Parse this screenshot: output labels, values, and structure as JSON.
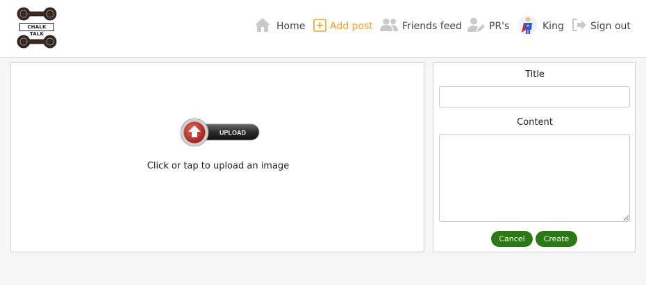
{
  "app": {
    "logo_text": "CHALK TALK"
  },
  "nav": {
    "home": "Home",
    "add_post": "Add post",
    "friends_feed": "Friends feed",
    "prs": "PR's",
    "user": "King",
    "sign_out": "Sign out"
  },
  "colors": {
    "active_nav": "#f0a41d",
    "button": "#2a7a14"
  },
  "upload": {
    "button_label": "UPLOAD",
    "hint": "Click or tap to upload an image"
  },
  "form": {
    "title_label": "Title",
    "title_value": "",
    "content_label": "Content",
    "content_value": "",
    "cancel": "Cancel",
    "create": "Create"
  }
}
